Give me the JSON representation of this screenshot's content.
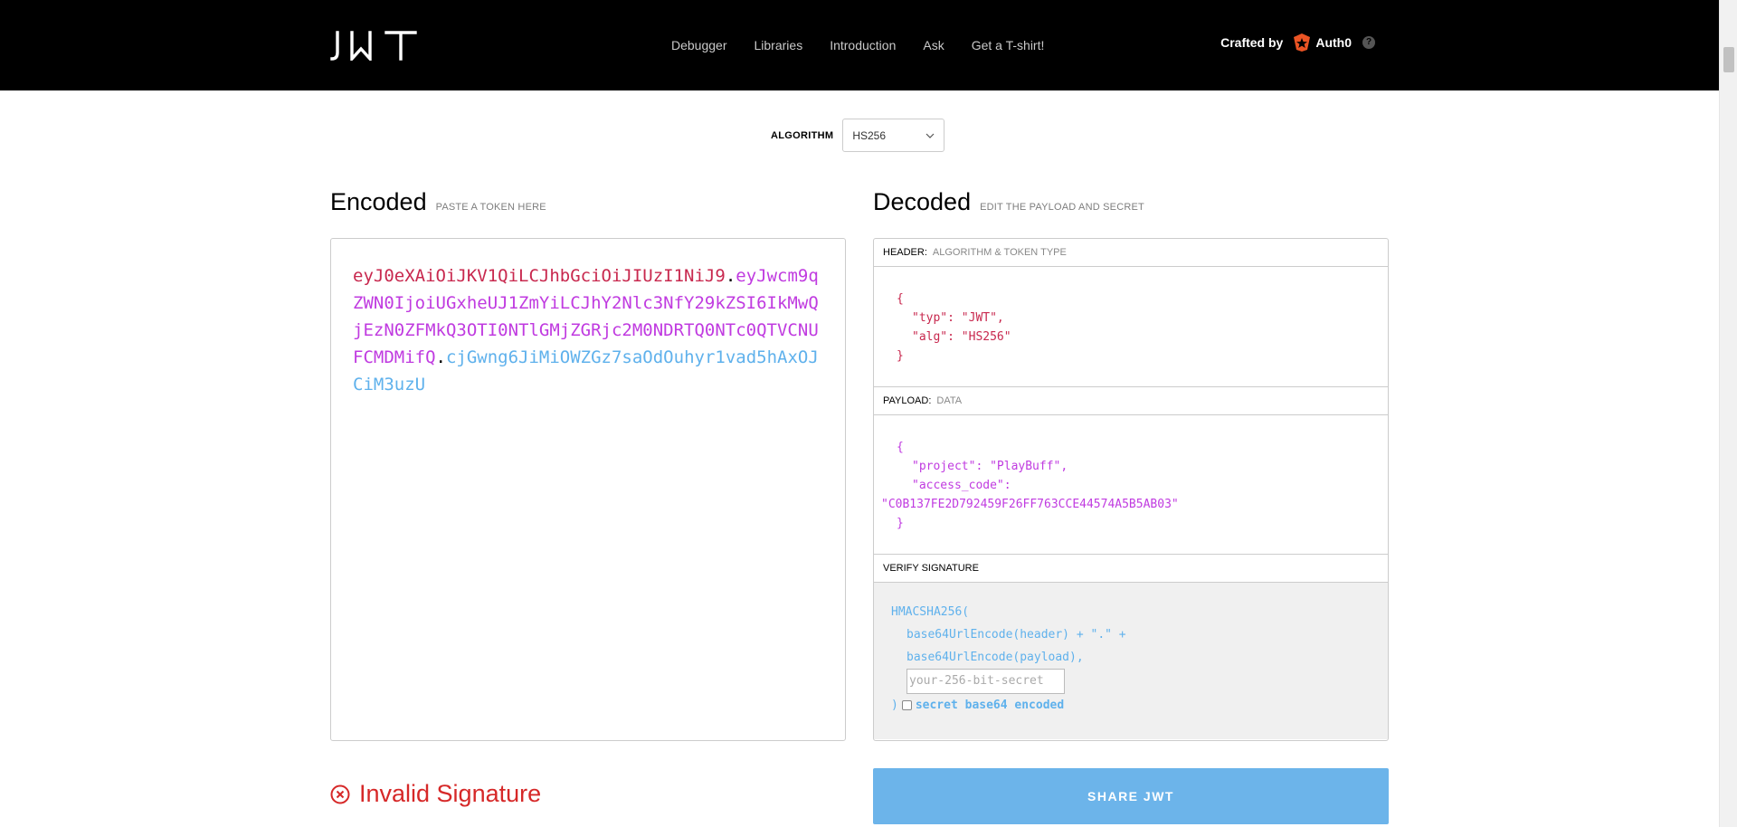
{
  "header": {
    "logo_text": "JWT",
    "nav": [
      "Debugger",
      "Libraries",
      "Introduction",
      "Ask",
      "Get a T-shirt!"
    ],
    "crafted_by_label": "Crafted by",
    "crafted_by_brand": "Auth0",
    "help_symbol": "?"
  },
  "algorithm": {
    "label": "ALGORITHM",
    "selected": "HS256"
  },
  "encoded": {
    "title": "Encoded",
    "hint": "PASTE A TOKEN HERE",
    "token_header": "eyJ0eXAiOiJKV1QiLCJhbGciOiJIUzI1NiJ9",
    "token_payload": "eyJwcm9qZWN0IjoiUGxheUJ1ZmYiLCJhY2Nlc3NfY29kZSI6IkMwQjEzN0ZFMkQ3OTI0NTlGMjZGRjc2M0NDRTQ0NTc0QTVCNUFCMDMifQ",
    "token_signature": "cjGwng6JiMiOWZGz7saOdOuhyr1vad5hAxOJCiM3uzU",
    "dot": "."
  },
  "decoded": {
    "title": "Decoded",
    "hint": "EDIT THE PAYLOAD AND SECRET",
    "header_section": {
      "label": "HEADER:",
      "sub": "ALGORITHM & TOKEN TYPE"
    },
    "header_json": {
      "open": "{",
      "line1": "\"typ\": \"JWT\",",
      "line2": "\"alg\": \"HS256\"",
      "close": "}"
    },
    "payload_section": {
      "label": "PAYLOAD:",
      "sub": "DATA"
    },
    "payload_json": {
      "open": "{",
      "line1": "\"project\": \"PlayBuff\",",
      "line2": "\"access_code\":",
      "line3": "\"C0B137FE2D792459F26FF763CCE44574A5B5AB03\"",
      "close": "}"
    },
    "verify_section": {
      "label": "VERIFY SIGNATURE"
    },
    "verify": {
      "fn": "HMACSHA256(",
      "line1": "base64UrlEncode(header) + \".\" +",
      "line2": "base64UrlEncode(payload),",
      "secret_placeholder": "your-256-bit-secret",
      "close": ")",
      "b64_label": "secret base64 encoded"
    }
  },
  "status": {
    "invalid_text": "Invalid Signature"
  },
  "share_button": "SHARE JWT",
  "colors": {
    "header_part": "#c8284e",
    "payload_part": "#c03be0",
    "signature_part": "#5fb1ec",
    "invalid": "#d62828",
    "share_bg": "#6cb4ea"
  }
}
